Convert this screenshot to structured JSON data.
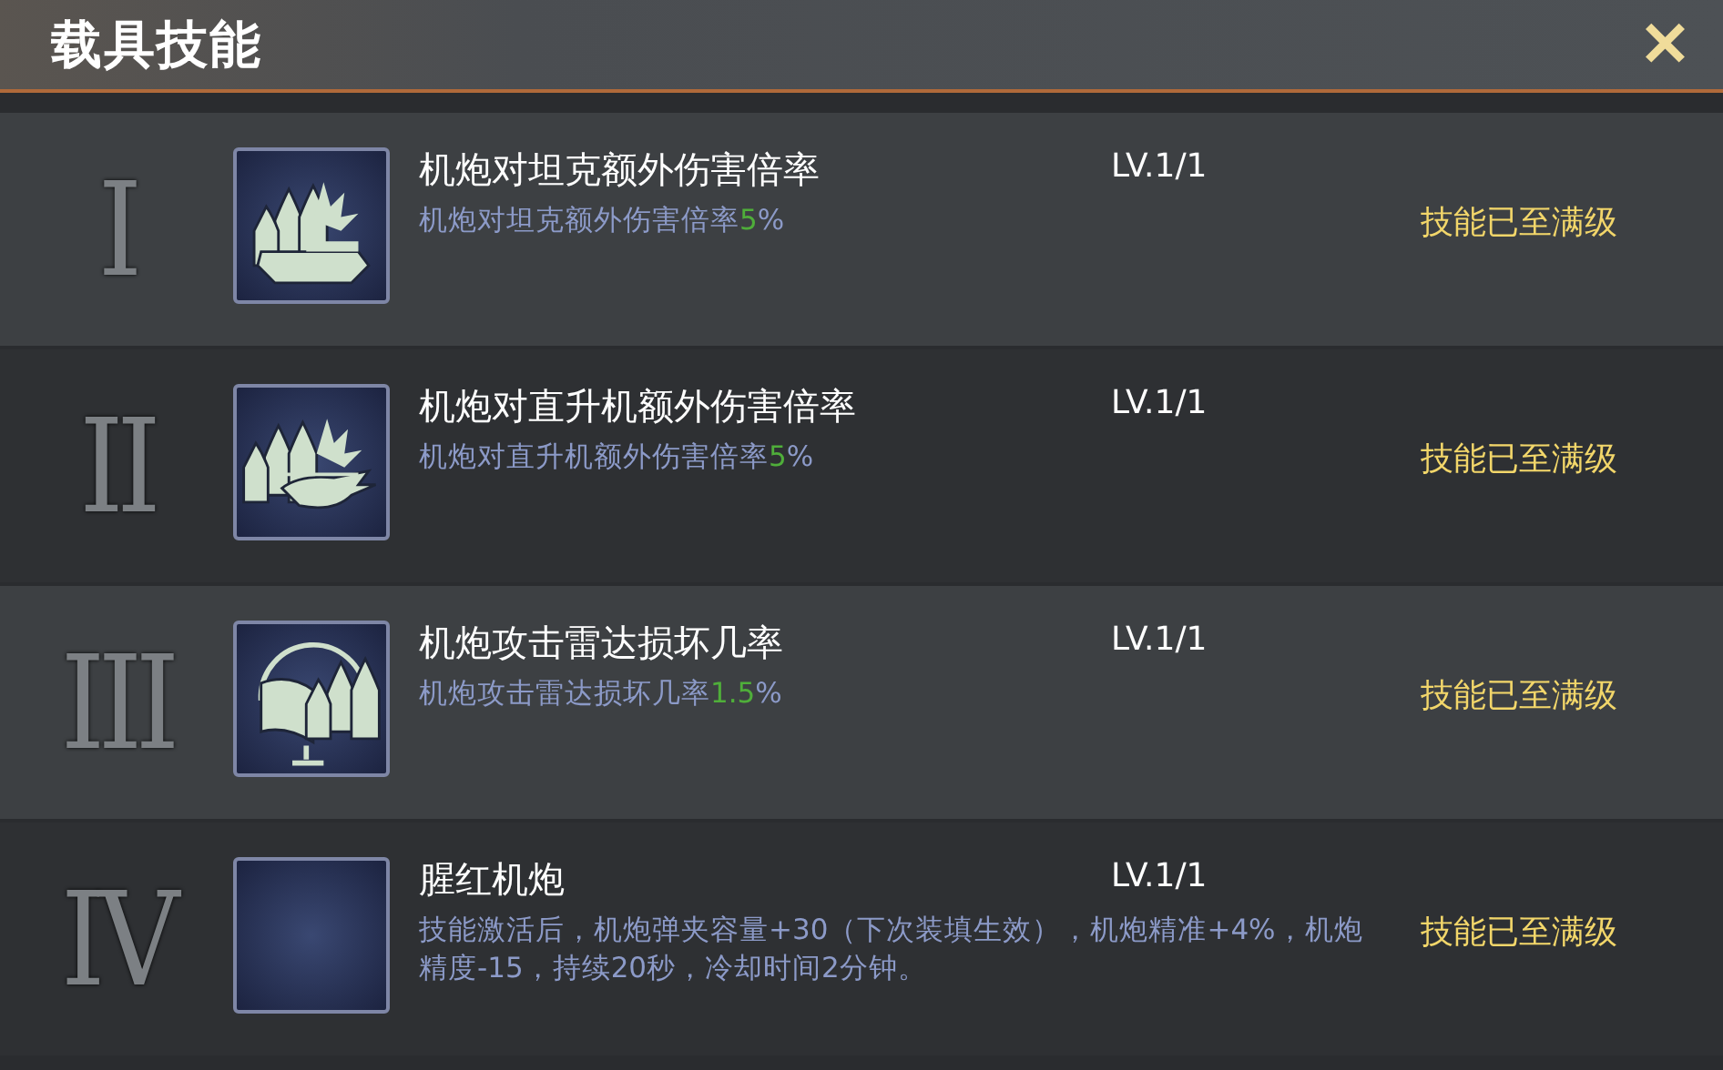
{
  "window": {
    "title": "载具技能",
    "close": "✕"
  },
  "skills": [
    {
      "numeral": "I",
      "name": "机炮对坦克额外伤害倍率",
      "level_text": "LV.1/1",
      "status": "技能已至满级",
      "description": [
        {
          "text": "机炮对坦克额外伤害倍率",
          "highlight": false
        },
        {
          "text": "5",
          "highlight": true
        },
        {
          "text": "%",
          "highlight": false
        }
      ]
    },
    {
      "numeral": "II",
      "name": "机炮对直升机额外伤害倍率",
      "level_text": "LV.1/1",
      "status": "技能已至满级",
      "description": [
        {
          "text": "机炮对直升机额外伤害倍率",
          "highlight": false
        },
        {
          "text": "5",
          "highlight": true
        },
        {
          "text": "%",
          "highlight": false
        }
      ]
    },
    {
      "numeral": "III",
      "name": "机炮攻击雷达损坏几率",
      "level_text": "LV.1/1",
      "status": "技能已至满级",
      "description": [
        {
          "text": "机炮攻击雷达损坏几率",
          "highlight": false
        },
        {
          "text": "1.5",
          "highlight": true
        },
        {
          "text": "%",
          "highlight": false
        }
      ]
    },
    {
      "numeral": "IV",
      "name": "腥红机炮",
      "level_text": "LV.1/1",
      "status": "技能已至满级",
      "description": [
        {
          "text": "技能激活后，机炮弹夹容量+30（下次装填生效），机炮精准+4%，机炮精度-15，持续20秒，冷却时间2分钟。",
          "highlight": false
        }
      ]
    }
  ]
}
